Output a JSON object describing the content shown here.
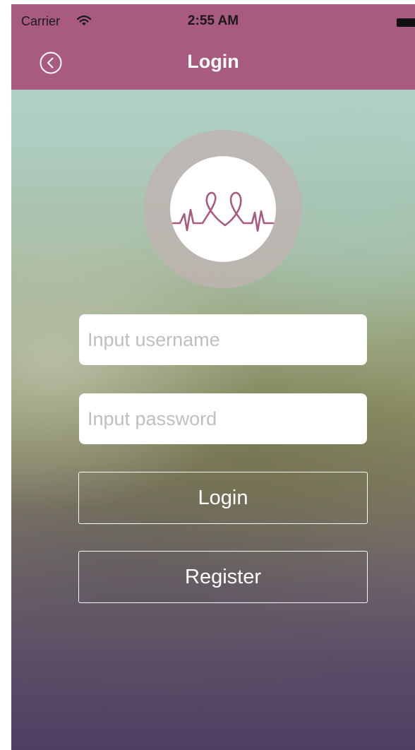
{
  "status_bar": {
    "carrier": "Carrier",
    "time": "2:55 AM",
    "icons": [
      "wifi-icon",
      "battery-icon"
    ]
  },
  "nav": {
    "title": "Login",
    "back_icon": "back-circle-icon"
  },
  "logo": {
    "icon": "heartbeat-heart-icon",
    "accent_color": "#a85a80"
  },
  "form": {
    "username_placeholder": "Input username",
    "password_placeholder": "Input password",
    "login_label": "Login",
    "register_label": "Register"
  },
  "colors": {
    "bar": "#a85a80",
    "title_text": "#ffffff"
  }
}
